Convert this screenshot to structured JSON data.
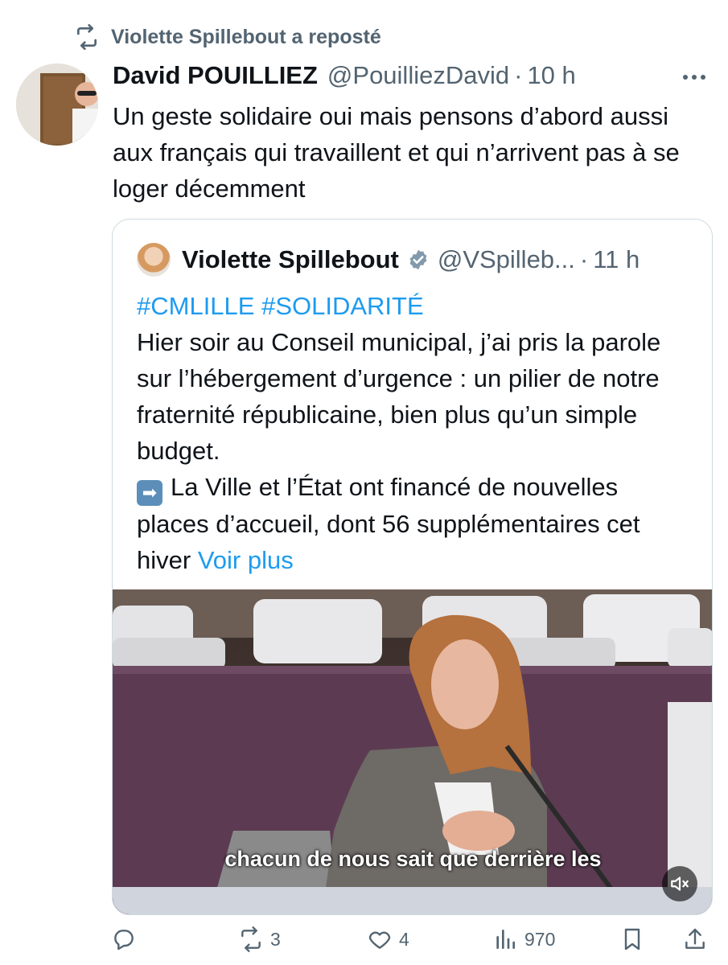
{
  "repost": {
    "text": "Violette Spillebout a reposté",
    "icon": "repost-icon"
  },
  "tweet": {
    "author_name": "David POUILLIEZ",
    "handle": "@PouilliezDavid",
    "separator": "·",
    "time": "10 h",
    "text": "Un geste solidaire oui mais pensons d’abord aussi aux français qui travaillent et qui n’arrivent pas à se loger décemment"
  },
  "quote": {
    "author_name": "Violette Spillebout",
    "handle": "@VSpilleb...",
    "separator": "·",
    "time": "11 h",
    "hashtag1": "#CMLILLE",
    "hashtag2": "#SOLIDARITÉ",
    "text_main": "Hier soir au Conseil municipal, j’ai pris la parole sur l’hébergement d’urgence : un pilier de notre fraternité républicaine, bien plus qu’un simple budget.",
    "text_arrow": "La Ville et l’État ont financé de nouvelles places d’accueil, dont 56 supplémentaires cet hiver",
    "arrow_emoji": "➡",
    "see_more": "Voir plus",
    "video_caption": "chacun de nous sait que derrière les"
  },
  "actions": {
    "reply_count": "",
    "repost_count": "3",
    "like_count": "4",
    "views_count": "970"
  },
  "colors": {
    "link": "#1d9bf0",
    "muted": "#536471",
    "text": "#0f1419",
    "border": "#cfd9de"
  }
}
